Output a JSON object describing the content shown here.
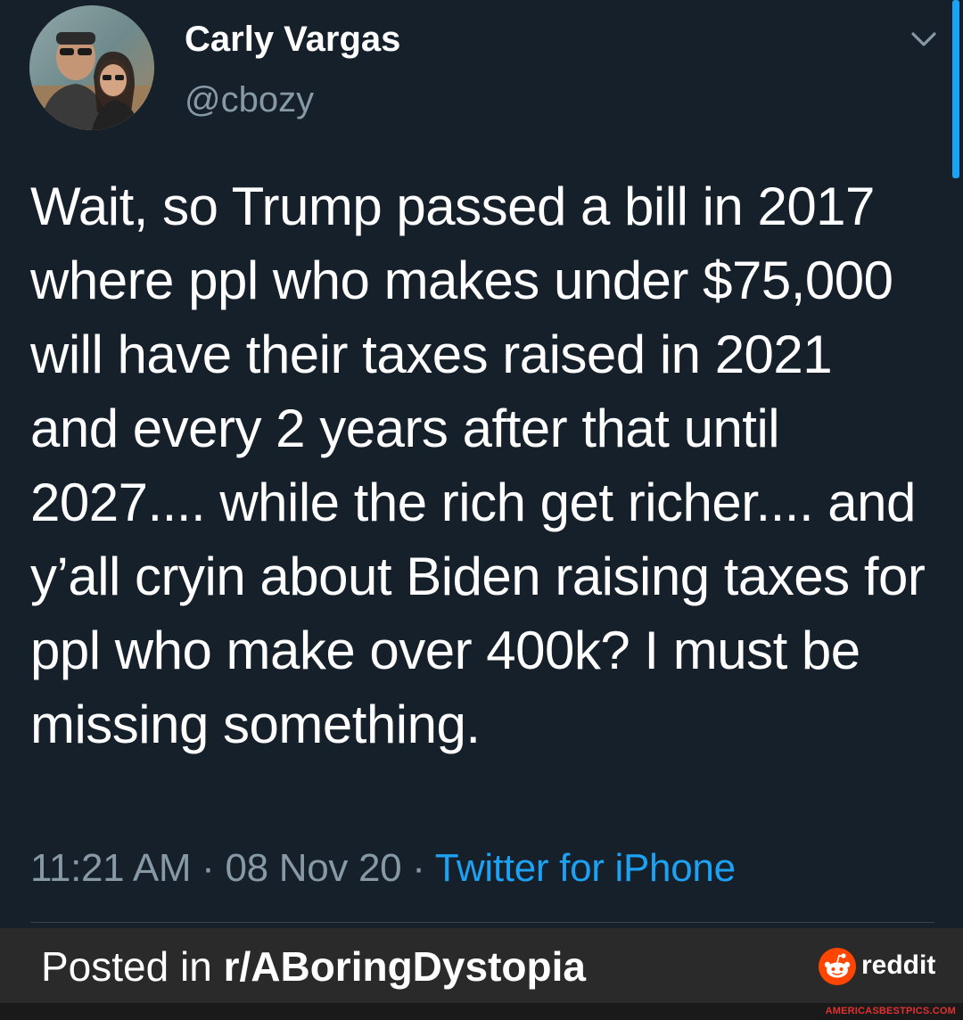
{
  "tweet": {
    "author": {
      "name": "Carly Vargas",
      "handle": "@cbozy"
    },
    "text": "Wait, so Trump passed a bill in 2017 where ppl who makes under $75,000 will have their taxes raised in 2021 and every 2 years after that until 2027.... while the rich get richer.... and y’all cryin about Biden raising taxes for ppl who make over 400k? I must be missing something.",
    "meta": {
      "time": "11:21 AM",
      "separator": " · ",
      "date": "08 Nov 20",
      "source": "Twitter for iPhone"
    },
    "icons": {
      "menu": "chevron-down-icon"
    },
    "colors": {
      "background": "#15202b",
      "link": "#1da1f2",
      "muted": "#8899a6"
    }
  },
  "footer": {
    "posted_prefix": "Posted in ",
    "subreddit": "r/ABoringDystopia",
    "brand": "reddit",
    "brand_color": "#ff4500",
    "watermark": "AMERICASBESTPICS.COM"
  }
}
